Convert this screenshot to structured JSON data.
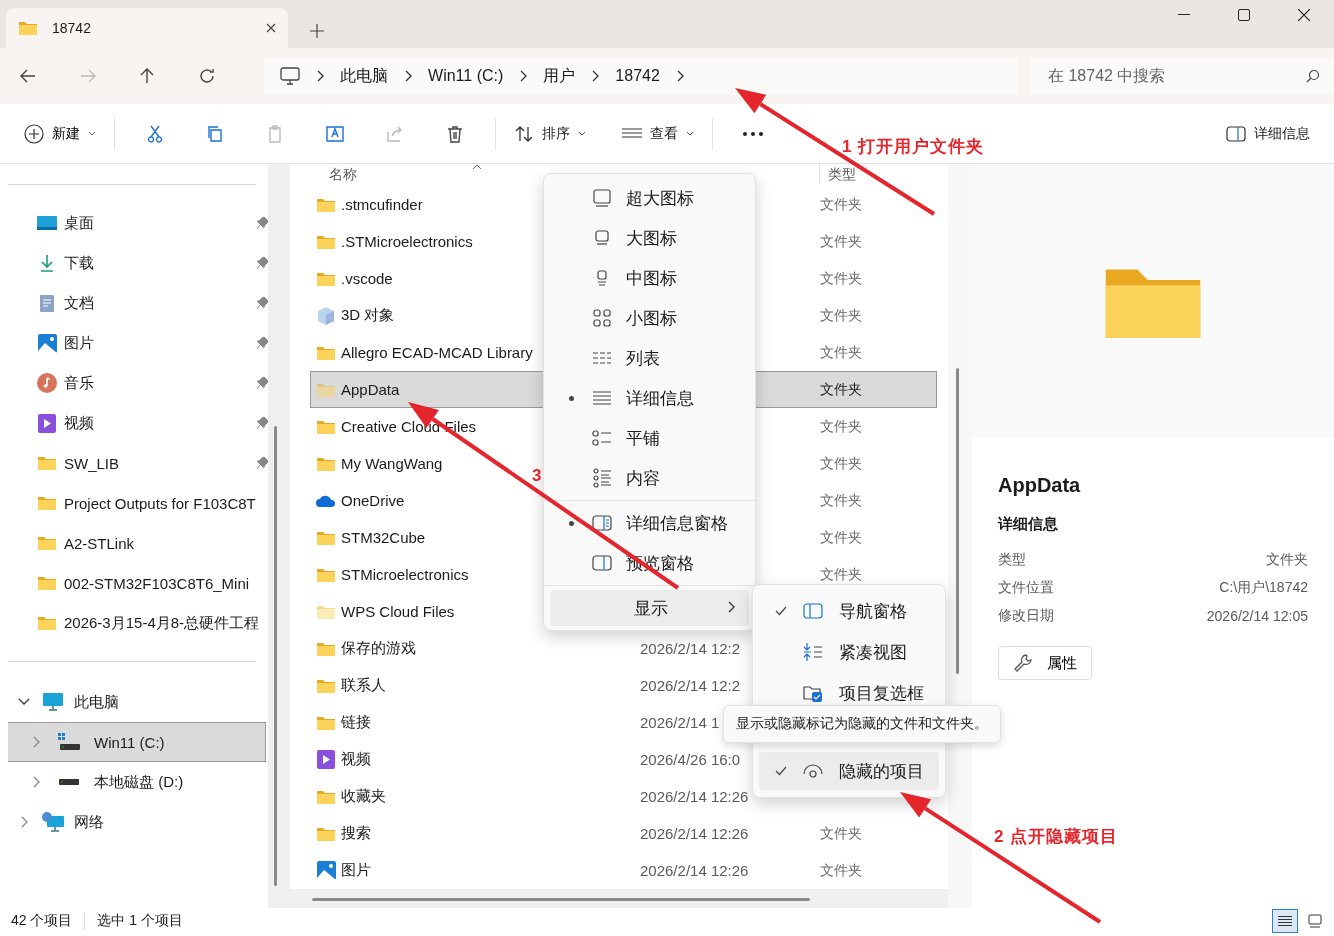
{
  "title_bar": {
    "tab_title": "18742"
  },
  "address_bar": {
    "breadcrumbs": [
      "此电脑",
      "Win11 (C:)",
      "用户",
      "18742"
    ],
    "search": {
      "placeholder": "在 18742 中搜索"
    }
  },
  "command_bar": {
    "new": "新建",
    "sort": "排序",
    "view": "查看",
    "details": "详细信息"
  },
  "navigation": {
    "quick_access": [
      {
        "label": "桌面",
        "kind": "desktop",
        "pinned": true
      },
      {
        "label": "下载",
        "kind": "download",
        "pinned": true
      },
      {
        "label": "文档",
        "kind": "documents",
        "pinned": true
      },
      {
        "label": "图片",
        "kind": "pictures",
        "pinned": true
      },
      {
        "label": "音乐",
        "kind": "music",
        "pinned": true
      },
      {
        "label": "视频",
        "kind": "videos",
        "pinned": true
      },
      {
        "label": "SW_LIB",
        "kind": "folder",
        "pinned": true
      },
      {
        "label": "Project Outputs for F103C8T",
        "kind": "folder",
        "pinned": false
      },
      {
        "label": "A2-STLink",
        "kind": "folder",
        "pinned": false
      },
      {
        "label": "002-STM32F103C8T6_Mini",
        "kind": "folder",
        "pinned": false
      },
      {
        "label": "2026-3月15-4月8-总硬件工程",
        "kind": "folder",
        "pinned": false
      }
    ],
    "tree": [
      {
        "label": "此电脑",
        "kind": "pc",
        "expanded": true,
        "selected": false,
        "children": [
          {
            "label": "Win11 (C:)",
            "kind": "system-drive",
            "expanded": false,
            "selected": true
          },
          {
            "label": "本地磁盘 (D:)",
            "kind": "drive",
            "expanded": false,
            "selected": false
          }
        ]
      },
      {
        "label": "网络",
        "kind": "network",
        "expanded": false,
        "selected": false
      }
    ]
  },
  "file_list": {
    "columns": {
      "name": "名称",
      "type": "类型"
    },
    "rows": [
      {
        "name": ".stmcufinder",
        "kind": "folder",
        "hidden": false,
        "selected": false,
        "type": "文件夹"
      },
      {
        "name": ".STMicroelectronics",
        "kind": "folder",
        "hidden": false,
        "selected": false,
        "type": "文件夹"
      },
      {
        "name": ".vscode",
        "kind": "folder",
        "hidden": false,
        "selected": false,
        "type": "文件夹"
      },
      {
        "name": "3D 对象",
        "kind": "cube",
        "hidden": false,
        "selected": false,
        "type": "文件夹"
      },
      {
        "name": "Allegro ECAD-MCAD Library",
        "kind": "folder",
        "hidden": false,
        "selected": false,
        "type": "文件夹"
      },
      {
        "name": "AppData",
        "kind": "folder",
        "hidden": true,
        "selected": true,
        "type": "文件夹"
      },
      {
        "name": "Creative Cloud Files",
        "kind": "folder",
        "hidden": false,
        "selected": false,
        "type": "文件夹"
      },
      {
        "name": "My WangWang",
        "kind": "folder",
        "hidden": false,
        "selected": false,
        "type": "文件夹"
      },
      {
        "name": "OneDrive",
        "kind": "cloud",
        "hidden": false,
        "selected": false,
        "type": "文件夹"
      },
      {
        "name": "STM32Cube",
        "kind": "folder",
        "hidden": false,
        "selected": false,
        "type": "文件夹"
      },
      {
        "name": "STMicroelectronics",
        "kind": "folder",
        "hidden": false,
        "selected": false,
        "type": "文件夹"
      },
      {
        "name": "WPS Cloud Files",
        "kind": "folder",
        "hidden": true,
        "selected": false
      },
      {
        "name": "保存的游戏",
        "kind": "folder",
        "hidden": false,
        "selected": false,
        "date": "2026/2/14 12:2"
      },
      {
        "name": "联系人",
        "kind": "folder",
        "hidden": false,
        "selected": false,
        "date": "2026/2/14 12:2"
      },
      {
        "name": "链接",
        "kind": "folder",
        "hidden": false,
        "selected": false,
        "date": "2026/2/14 1"
      },
      {
        "name": "视频",
        "kind": "videos",
        "hidden": false,
        "selected": false,
        "date": "2026/4/26 16:0"
      },
      {
        "name": "收藏夹",
        "kind": "folder",
        "hidden": false,
        "selected": false,
        "date": "2026/2/14 12:26"
      },
      {
        "name": "搜索",
        "kind": "folder",
        "hidden": false,
        "selected": false,
        "date": "2026/2/14 12:26",
        "type": "文件夹"
      },
      {
        "name": "图片",
        "kind": "pictures",
        "hidden": false,
        "selected": false,
        "date": "2026/2/14 12:26",
        "type": "文件夹"
      }
    ]
  },
  "view_menu": {
    "sections": [
      {
        "items": [
          {
            "label": "超大图标",
            "kind": "extra-large",
            "selected": false
          },
          {
            "label": "大图标",
            "kind": "large",
            "selected": false
          },
          {
            "label": "中图标",
            "kind": "medium",
            "selected": false
          },
          {
            "label": "小图标",
            "kind": "small",
            "selected": false
          },
          {
            "label": "列表",
            "kind": "list",
            "selected": false
          },
          {
            "label": "详细信息",
            "kind": "details",
            "selected": true
          },
          {
            "label": "平铺",
            "kind": "tiles",
            "selected": false
          },
          {
            "label": "内容",
            "kind": "content",
            "selected": false
          }
        ]
      },
      {
        "items": [
          {
            "label": "详细信息窗格",
            "kind": "details-pane",
            "selected": true
          },
          {
            "label": "预览窗格",
            "kind": "preview-pane",
            "selected": false
          }
        ]
      }
    ],
    "show": {
      "label": "显示",
      "highlighted": true
    }
  },
  "show_menu": {
    "items": [
      {
        "label": "导航窗格",
        "kind": "nav-pane",
        "checked": true,
        "highlighted": false
      },
      {
        "label": "紧凑视图",
        "kind": "compact",
        "checked": false,
        "highlighted": false
      },
      {
        "label": "项目复选框",
        "kind": "checkboxes",
        "checked": false,
        "highlighted": false
      },
      {
        "label": "隐藏的项目",
        "kind": "hidden-items",
        "checked": true,
        "highlighted": true
      }
    ]
  },
  "tooltip": {
    "text": "显示或隐藏标记为隐藏的文件和文件夹。"
  },
  "details_pane": {
    "name": "AppData",
    "heading": "详细信息",
    "properties": [
      {
        "label": "类型",
        "value": "文件夹"
      },
      {
        "label": "文件位置",
        "value": "C:\\用户\\18742"
      },
      {
        "label": "修改日期",
        "value": "2026/2/14 12:05"
      }
    ],
    "button": "属性"
  },
  "status_bar": {
    "item_count": "42 个项目",
    "selection": "选中 1 个项目",
    "views": [
      {
        "kind": "details",
        "selected": true
      },
      {
        "kind": "large-icons",
        "selected": false
      }
    ]
  },
  "annotations": [
    {
      "label": "1 打开用户文件夹"
    },
    {
      "label": "2 点开隐藏项目"
    },
    {
      "label": "3"
    }
  ]
}
